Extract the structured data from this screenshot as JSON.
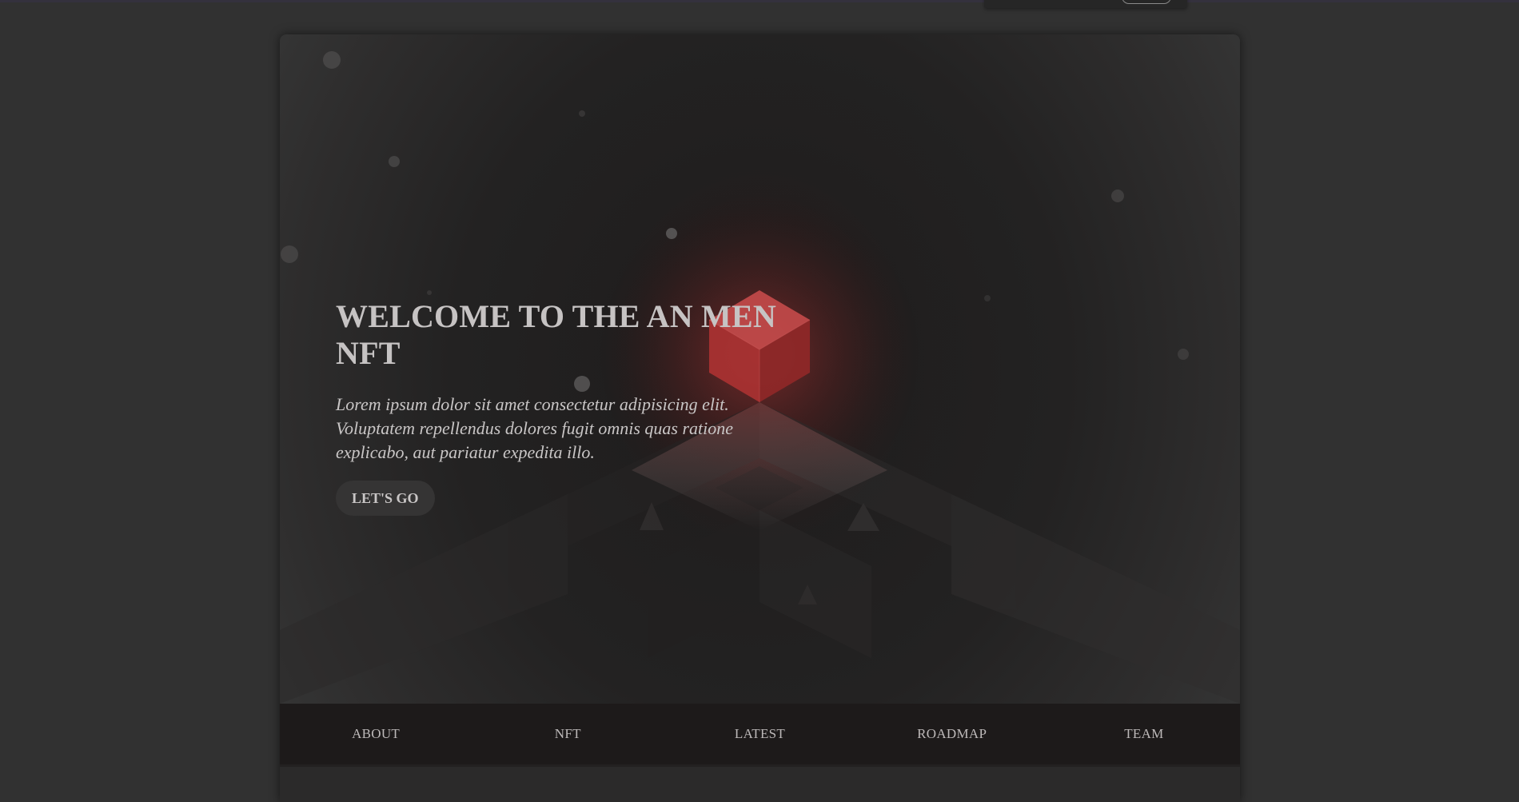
{
  "hero": {
    "title": "WELCOME TO THE AN MEN NFT",
    "text": "Lorem ipsum dolor sit amet consectetur adipisicing elit. Voluptatem repellendus dolores fugit omnis quas ratione explicabo, aut pariatur expedita illo.",
    "button_label": "LET'S GO"
  },
  "nav": {
    "items": [
      {
        "label": "ABOUT"
      },
      {
        "label": "NFT"
      },
      {
        "label": "LATEST"
      },
      {
        "label": "ROADMAP"
      },
      {
        "label": "TEAM"
      }
    ]
  },
  "colors": {
    "page_background": "#313131",
    "hero_background": "#1f1d1d",
    "cube_red": "#b83a3a",
    "nav_background": "#1d1a1a",
    "text": "#c6c3c3"
  },
  "icons": {
    "hero_art": "red-cube-icon"
  }
}
